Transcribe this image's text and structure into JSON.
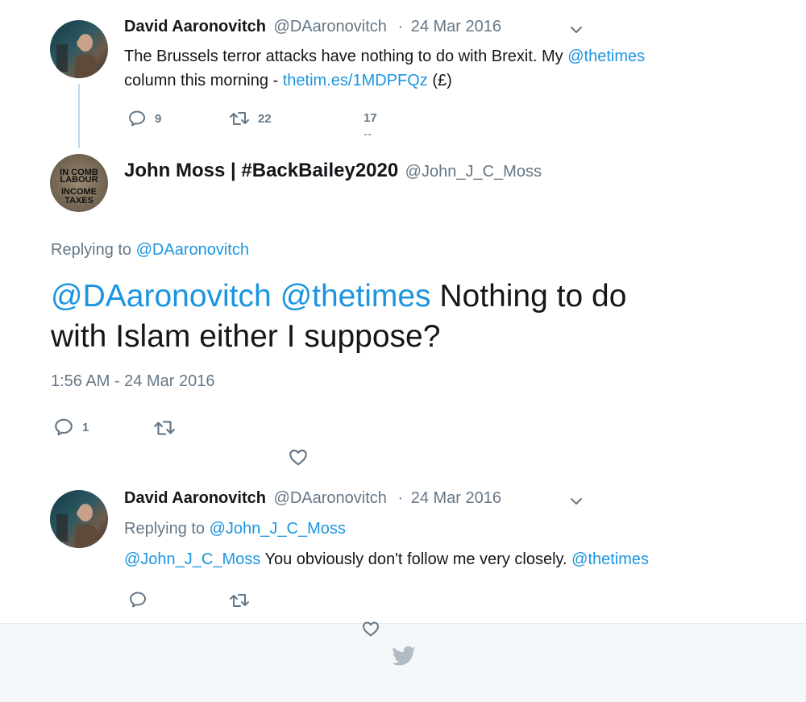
{
  "tweet1": {
    "name": "David Aaronovitch",
    "handle": "@DAaronovitch",
    "dot": "·",
    "date": "24 Mar 2016",
    "text_part1": "The Brussels terror attacks have nothing to do with Brexit. My ",
    "mention": "@thetimes",
    "text_part2": "column this morning - ",
    "link": "thetim.es/1MDPFQz",
    "text_part3": " (£)",
    "replies": "9",
    "retweets": "22",
    "likes": "17",
    "likes_sub": "--"
  },
  "main": {
    "name": "John Moss | #BackBailey2020",
    "handle": "@John_J_C_Moss",
    "avatar_lines": [
      "IN COMB",
      "LABOUR",
      "INCOME",
      "TAXES"
    ],
    "replying_prefix": "Replying to ",
    "replying_to": "@DAaronovitch",
    "mention1": "@DAaronovitch",
    "mention2": "@thetimes",
    "text_line1": " Nothing to do",
    "text_line2": "with Islam either I suppose?",
    "timestamp": "1:56 AM - 24 Mar 2016",
    "replies": "1"
  },
  "tweet3": {
    "name": "David Aaronovitch",
    "handle": "@DAaronovitch",
    "dot": "·",
    "date": "24 Mar 2016",
    "replying_prefix": "Replying to ",
    "replying_to": "@John_J_C_Moss",
    "mention1": "@John_J_C_Moss",
    "text": " You obviously don't follow me very closely. ",
    "mention2": "@thetimes"
  },
  "colors": {
    "link": "#1b95e0",
    "muted": "#657786",
    "text": "#14171a",
    "thread_line": "#b7dcf5",
    "footer_bg": "#f5f8fa"
  },
  "icons": [
    "reply-icon",
    "retweet-icon",
    "heart-icon",
    "chevron-down-icon",
    "twitter-bird-icon"
  ]
}
